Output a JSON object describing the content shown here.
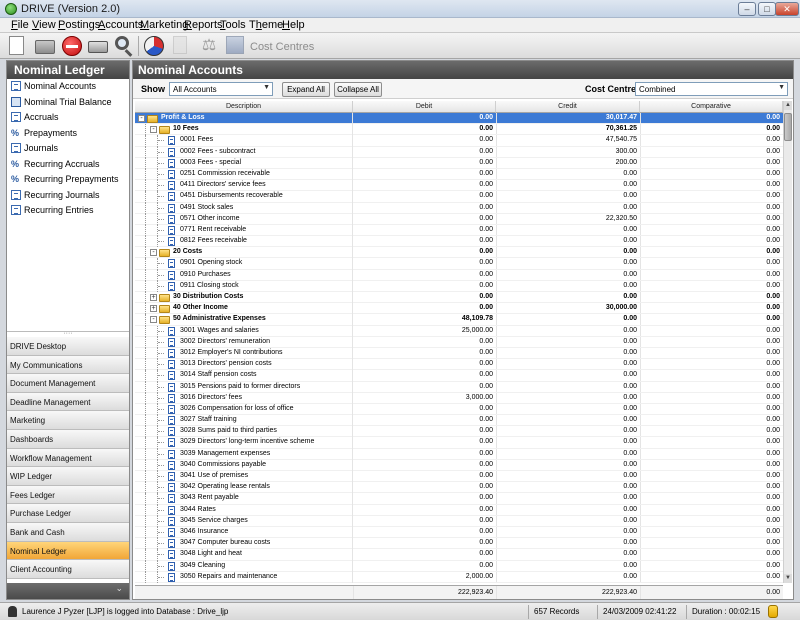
{
  "window": {
    "title": "DRIVE (Version 2.0)",
    "minimize_glyph": "–",
    "maximize_glyph": "□",
    "close_glyph": "✕"
  },
  "menu": [
    {
      "label": "File",
      "key": "F"
    },
    {
      "label": "View",
      "key": "V"
    },
    {
      "label": "Postings",
      "key": "P"
    },
    {
      "label": "Accounts",
      "key": "A"
    },
    {
      "label": "Marketing",
      "key": "M"
    },
    {
      "label": "Reports",
      "key": "R"
    },
    {
      "label": "Tools",
      "key": "T"
    },
    {
      "label": "Theme",
      "key": "h"
    },
    {
      "label": "Help",
      "key": "H"
    }
  ],
  "toolbar": {
    "icons": [
      "new-icon",
      "open-icon",
      "stop-icon",
      "print-icon",
      "search-icon",
      "chart-icon",
      "document-icon",
      "scales-icon",
      "cost-centres-icon"
    ],
    "scales_glyph": "⚖",
    "cost_centres_label": "Cost Centres"
  },
  "left_panel": {
    "title": "Nominal Ledger",
    "items": [
      {
        "label": "Nominal Accounts",
        "icon": "doc-icon"
      },
      {
        "label": "Nominal Trial Balance",
        "icon": "book-icon"
      },
      {
        "label": "Accruals",
        "icon": "doc-icon"
      },
      {
        "label": "Prepayments",
        "icon": "percent-icon"
      },
      {
        "label": "Journals",
        "icon": "doc-icon"
      },
      {
        "label": "Recurring Accruals",
        "icon": "percent-icon"
      },
      {
        "label": "Recurring Prepayments",
        "icon": "percent-icon"
      },
      {
        "label": "Recurring Journals",
        "icon": "doc-icon"
      },
      {
        "label": "Recurring Entries",
        "icon": "doc-icon"
      }
    ],
    "percent_glyph": "%",
    "splitter_glyph": "····",
    "modules": [
      "DRIVE Desktop",
      "My Communications",
      "Document Management",
      "Deadline Management",
      "Marketing",
      "Dashboards",
      "Workflow Management",
      "WIP Ledger",
      "Fees Ledger",
      "Purchase Ledger",
      "Bank and Cash",
      "Nominal Ledger",
      "Client Accounting"
    ],
    "active_module": "Nominal Ledger",
    "footer_glyph": "⌄"
  },
  "main": {
    "title": "Nominal Accounts",
    "show_label": "Show",
    "show_value": "All Accounts",
    "expand_all": "Expand All",
    "collapse_all": "Collapse All",
    "cost_centre_label": "Cost Centre",
    "cost_centre_value": "Combined",
    "combo_arrow": "▼",
    "scroll_up": "▲",
    "scroll_down": "▼",
    "columns": {
      "description": "Description",
      "debit": "Debit",
      "credit": "Credit",
      "comparative": "Comparative"
    },
    "rows": [
      {
        "level": 0,
        "type": "group",
        "exp": "-",
        "desc": "Profit & Loss",
        "debit": "0.00",
        "credit": "30,017.47",
        "comp": "0.00",
        "selected": true
      },
      {
        "level": 1,
        "type": "group",
        "exp": "-",
        "desc": "10  Fees",
        "debit": "0.00",
        "credit": "70,361.25",
        "comp": "0.00"
      },
      {
        "level": 2,
        "type": "leaf",
        "desc": "0001  Fees",
        "debit": "0.00",
        "credit": "47,540.75",
        "comp": "0.00"
      },
      {
        "level": 2,
        "type": "leaf",
        "desc": "0002  Fees - subcontract",
        "debit": "0.00",
        "credit": "300.00",
        "comp": "0.00"
      },
      {
        "level": 2,
        "type": "leaf",
        "desc": "0003  Fees - special",
        "debit": "0.00",
        "credit": "200.00",
        "comp": "0.00"
      },
      {
        "level": 2,
        "type": "leaf",
        "desc": "0251  Commission receivable",
        "debit": "0.00",
        "credit": "0.00",
        "comp": "0.00"
      },
      {
        "level": 2,
        "type": "leaf",
        "desc": "0411  Directors' service fees",
        "debit": "0.00",
        "credit": "0.00",
        "comp": "0.00"
      },
      {
        "level": 2,
        "type": "leaf",
        "desc": "0451  Disbursements recoverable",
        "debit": "0.00",
        "credit": "0.00",
        "comp": "0.00"
      },
      {
        "level": 2,
        "type": "leaf",
        "desc": "0491  Stock sales",
        "debit": "0.00",
        "credit": "0.00",
        "comp": "0.00"
      },
      {
        "level": 2,
        "type": "leaf",
        "desc": "0571  Other income",
        "debit": "0.00",
        "credit": "22,320.50",
        "comp": "0.00"
      },
      {
        "level": 2,
        "type": "leaf",
        "desc": "0771  Rent receivable",
        "debit": "0.00",
        "credit": "0.00",
        "comp": "0.00"
      },
      {
        "level": 2,
        "type": "leaf",
        "desc": "0812  Fees receivable",
        "debit": "0.00",
        "credit": "0.00",
        "comp": "0.00"
      },
      {
        "level": 1,
        "type": "group",
        "exp": "-",
        "desc": "20  Costs",
        "debit": "0.00",
        "credit": "0.00",
        "comp": "0.00"
      },
      {
        "level": 2,
        "type": "leaf",
        "desc": "0901  Opening stock",
        "debit": "0.00",
        "credit": "0.00",
        "comp": "0.00"
      },
      {
        "level": 2,
        "type": "leaf",
        "desc": "0910  Purchases",
        "debit": "0.00",
        "credit": "0.00",
        "comp": "0.00"
      },
      {
        "level": 2,
        "type": "leaf",
        "desc": "0911  Closing stock",
        "debit": "0.00",
        "credit": "0.00",
        "comp": "0.00"
      },
      {
        "level": 1,
        "type": "group",
        "exp": "+",
        "desc": "30  Distribution Costs",
        "debit": "0.00",
        "credit": "0.00",
        "comp": "0.00"
      },
      {
        "level": 1,
        "type": "group",
        "exp": "+",
        "desc": "40  Other Income",
        "debit": "0.00",
        "credit": "30,000.00",
        "comp": "0.00"
      },
      {
        "level": 1,
        "type": "group",
        "exp": "-",
        "desc": "50  Administrative Expenses",
        "debit": "48,109.78",
        "credit": "0.00",
        "comp": "0.00"
      },
      {
        "level": 2,
        "type": "leaf",
        "desc": "3001  Wages and salaries",
        "debit": "25,000.00",
        "credit": "0.00",
        "comp": "0.00"
      },
      {
        "level": 2,
        "type": "leaf",
        "desc": "3002  Directors' remuneration",
        "debit": "0.00",
        "credit": "0.00",
        "comp": "0.00"
      },
      {
        "level": 2,
        "type": "leaf",
        "desc": "3012  Employer's NI contributions",
        "debit": "0.00",
        "credit": "0.00",
        "comp": "0.00"
      },
      {
        "level": 2,
        "type": "leaf",
        "desc": "3013  Directors' pension costs",
        "debit": "0.00",
        "credit": "0.00",
        "comp": "0.00"
      },
      {
        "level": 2,
        "type": "leaf",
        "desc": "3014  Staff pension costs",
        "debit": "0.00",
        "credit": "0.00",
        "comp": "0.00"
      },
      {
        "level": 2,
        "type": "leaf",
        "desc": "3015  Pensions paid to former directors",
        "debit": "0.00",
        "credit": "0.00",
        "comp": "0.00"
      },
      {
        "level": 2,
        "type": "leaf",
        "desc": "3016  Directors' fees",
        "debit": "3,000.00",
        "credit": "0.00",
        "comp": "0.00"
      },
      {
        "level": 2,
        "type": "leaf",
        "desc": "3026  Compensation for loss of office",
        "debit": "0.00",
        "credit": "0.00",
        "comp": "0.00"
      },
      {
        "level": 2,
        "type": "leaf",
        "desc": "3027  Staff training",
        "debit": "0.00",
        "credit": "0.00",
        "comp": "0.00"
      },
      {
        "level": 2,
        "type": "leaf",
        "desc": "3028  Sums paid to third parties",
        "debit": "0.00",
        "credit": "0.00",
        "comp": "0.00"
      },
      {
        "level": 2,
        "type": "leaf",
        "desc": "3029  Directors' long-term incentive scheme",
        "debit": "0.00",
        "credit": "0.00",
        "comp": "0.00"
      },
      {
        "level": 2,
        "type": "leaf",
        "desc": "3039  Management expenses",
        "debit": "0.00",
        "credit": "0.00",
        "comp": "0.00"
      },
      {
        "level": 2,
        "type": "leaf",
        "desc": "3040  Commissions payable",
        "debit": "0.00",
        "credit": "0.00",
        "comp": "0.00"
      },
      {
        "level": 2,
        "type": "leaf",
        "desc": "3041  Use of premises",
        "debit": "0.00",
        "credit": "0.00",
        "comp": "0.00"
      },
      {
        "level": 2,
        "type": "leaf",
        "desc": "3042  Operating lease rentals",
        "debit": "0.00",
        "credit": "0.00",
        "comp": "0.00"
      },
      {
        "level": 2,
        "type": "leaf",
        "desc": "3043  Rent payable",
        "debit": "0.00",
        "credit": "0.00",
        "comp": "0.00"
      },
      {
        "level": 2,
        "type": "leaf",
        "desc": "3044  Rates",
        "debit": "0.00",
        "credit": "0.00",
        "comp": "0.00"
      },
      {
        "level": 2,
        "type": "leaf",
        "desc": "3045  Service charges",
        "debit": "0.00",
        "credit": "0.00",
        "comp": "0.00"
      },
      {
        "level": 2,
        "type": "leaf",
        "desc": "3046  Insurance",
        "debit": "0.00",
        "credit": "0.00",
        "comp": "0.00"
      },
      {
        "level": 2,
        "type": "leaf",
        "desc": "3047  Computer bureau costs",
        "debit": "0.00",
        "credit": "0.00",
        "comp": "0.00"
      },
      {
        "level": 2,
        "type": "leaf",
        "desc": "3048  Light and heat",
        "debit": "0.00",
        "credit": "0.00",
        "comp": "0.00"
      },
      {
        "level": 2,
        "type": "leaf",
        "desc": "3049  Cleaning",
        "debit": "0.00",
        "credit": "0.00",
        "comp": "0.00"
      },
      {
        "level": 2,
        "type": "leaf",
        "desc": "3050  Repairs and maintenance",
        "debit": "2,000.00",
        "credit": "0.00",
        "comp": "0.00"
      }
    ],
    "totals": {
      "debit": "222,923.40",
      "credit": "222,923.40",
      "comp": "0.00"
    }
  },
  "status": {
    "user_text": "Laurence J Pyzer [LJP] is logged into Database : Drive_ljp",
    "records": "657 Records",
    "datetime": "24/03/2009 02:41:22",
    "duration": "Duration : 00:02:15"
  },
  "colors": {
    "accent_header": "#454545",
    "selection": "#3c7ad5",
    "active_module": "#f1a637"
  }
}
